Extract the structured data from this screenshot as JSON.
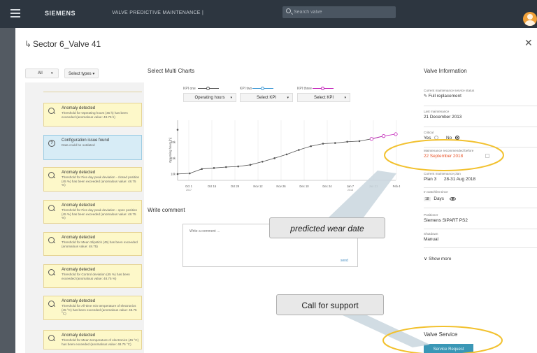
{
  "topbar": {
    "brand": "SIEMENS",
    "app_title": "VALVE PREDICTIVE MAINTENANCE |",
    "search_placeholder": "Search valve"
  },
  "page": {
    "back_glyph": "↳",
    "title": "Sector 6_Valve 41",
    "close_glyph": "✕"
  },
  "filters": {
    "all_label": "All",
    "types_label": "Select types ▾",
    "caret": "▾"
  },
  "cards": [
    {
      "kind": "anomaly",
      "title": "Anomaly detected",
      "desc": "Threshold for Operating hours (45 h) has been exceeded (anomalous value: 48.75 h)"
    },
    {
      "kind": "info",
      "title": "Configuration issue found",
      "desc": "Data could be outdated"
    },
    {
      "kind": "anomaly",
      "title": "Anomaly detected",
      "desc": "Threshold for Five day peak deviation - closed position (45 %) has been exceeded (anomalous value: 48.75 %)"
    },
    {
      "kind": "anomaly",
      "title": "Anomaly detected",
      "desc": "Threshold for Five day peak deviation - open position (45 %) has been exceeded (anomalous value: 48.75 %)"
    },
    {
      "kind": "anomaly",
      "title": "Anomaly detected",
      "desc": "Threshold for Mean Slipstick (45) has been exceeded (anomalous value: 48.75)"
    },
    {
      "kind": "anomaly",
      "title": "Anomaly detected",
      "desc": "Threshold for Control deviation (45 %) has been exceeded (anomalous value: 48.75 %)"
    },
    {
      "kind": "anomaly",
      "title": "Anomaly detected",
      "desc": "Threshold for All-time min temperature of electronics (45 °C) has been exceeded (anomalous value: 48.75 °C)"
    },
    {
      "kind": "anomaly",
      "title": "Anomaly detected",
      "desc": "Threshold for Mean temperature of electronics (45 °C) has been exceeded (anomalous value: 48.75 °C)"
    }
  ],
  "charts": {
    "title": "Select Multi Charts",
    "kpis": [
      {
        "label": "KPI one",
        "color": "#555555",
        "selected": "Operating hours"
      },
      {
        "label": "KPI two",
        "color": "#3a97d4",
        "selected": "Select KPI"
      },
      {
        "label": "KPI three",
        "color": "#c21fb8",
        "selected": "Select KPI"
      }
    ]
  },
  "chart_data": {
    "type": "line",
    "ylabel": "Operating hours [h]",
    "yticks": [
      "10k",
      "15k",
      "20k"
    ],
    "ylim": [
      8000,
      27000
    ],
    "xticks": [
      "Oct 1\n2017",
      "Oct 15",
      "Oct 29",
      "Nov 12",
      "Nov 26",
      "Dec 10",
      "Dec 24",
      "Jan 7\n2018",
      "Jan 21",
      "Feb 4"
    ],
    "series": [
      {
        "color": "#555555",
        "points": [
          [
            0,
            10000
          ],
          [
            1,
            10200
          ],
          [
            2,
            11600
          ],
          [
            3,
            11900
          ],
          [
            4,
            12200
          ],
          [
            5,
            12400
          ],
          [
            6,
            12900
          ],
          [
            7,
            13900
          ],
          [
            8,
            15000
          ],
          [
            9,
            16200
          ],
          [
            10,
            17600
          ],
          [
            11,
            18800
          ],
          [
            12,
            19600
          ],
          [
            13,
            19800
          ],
          [
            14,
            20200
          ],
          [
            15,
            20400
          ],
          [
            16,
            21100
          ],
          [
            17,
            22000
          ]
        ]
      },
      {
        "color": "#c21fb8",
        "points": [
          [
            16,
            21100
          ],
          [
            17,
            22000
          ],
          [
            18,
            22600
          ]
        ]
      }
    ],
    "outlier": [
      0,
      24000
    ],
    "xmax": 18
  },
  "comment": {
    "title": "Write comment",
    "placeholder": "Write a comment ...",
    "send_label": "send"
  },
  "valve_info": {
    "title": "Valve Information",
    "maintenance_status_label": "Current maintenance service status",
    "maintenance_status_value": "Full replacement",
    "last_maintenance_label": "Last maintenance",
    "last_maintenance_value": "21 December 2013",
    "critical_label": "Critical",
    "critical_yes": "Yes",
    "critical_no": "No",
    "recommended_label": "Maintenance recommended before",
    "recommended_value": "22 September 2018",
    "plan_label": "Current maintenance plan",
    "plan_name": "Plan 3",
    "plan_dates": "28-31 Aug 2018",
    "watchlist_label": "In watchlist since",
    "watchlist_count": "18",
    "watchlist_unit": "Days",
    "positioner_label": "Positioner",
    "positioner_value": "Siemens SIPART PS2",
    "shutdown_label": "Shutdown",
    "shutdown_value": "Manual",
    "show_more": "Show more"
  },
  "valve_service": {
    "title": "Valve Service",
    "button": "Service Request"
  },
  "annotations": {
    "wear_date": "predicted wear date",
    "support": "Call for support"
  },
  "colors": {
    "topbar": "#2d3640",
    "highlight_ring": "#f2c12e",
    "recommended": "#e8552a",
    "service_button": "#3a97b6",
    "anomaly_card": "#fdf8c9",
    "info_card": "#d7ecf6"
  }
}
